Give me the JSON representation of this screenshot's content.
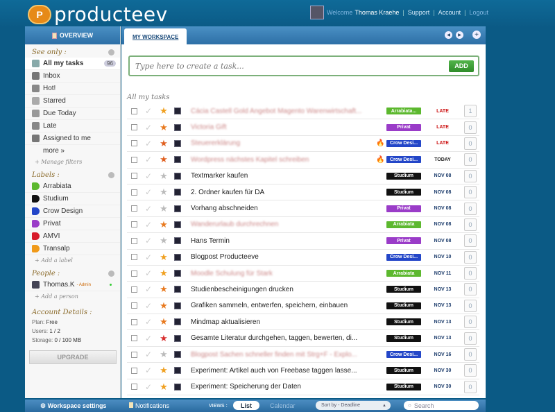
{
  "app": {
    "name": "producteev"
  },
  "user": {
    "welcome": "Welcome",
    "name": "Thomas Kraehe",
    "support": "Support",
    "account": "Account",
    "logout": "Logout"
  },
  "sidebar": {
    "tab": "OVERVIEW",
    "see_only_title": "See only :",
    "see_only": [
      {
        "label": "All my tasks",
        "count": "96",
        "icon": "list-icon",
        "color": "#8aa"
      },
      {
        "label": "Inbox",
        "icon": "inbox-icon",
        "color": "#777"
      },
      {
        "label": "Hot!",
        "icon": "fire-icon",
        "color": "#888"
      },
      {
        "label": "Starred",
        "icon": "star-icon",
        "color": "#aaa"
      },
      {
        "label": "Due Today",
        "icon": "calendar-icon",
        "color": "#999"
      },
      {
        "label": "Late",
        "icon": "warning-icon",
        "color": "#888"
      },
      {
        "label": "Assigned to me",
        "icon": "assign-icon",
        "color": "#777"
      }
    ],
    "more": "more »",
    "manage_filters": "Manage filters",
    "labels_title": "Labels :",
    "labels": [
      {
        "label": "Arrabiata",
        "color": "#5cb82e"
      },
      {
        "label": "Studium",
        "color": "#111111"
      },
      {
        "label": "Crow Design",
        "color": "#2346c8"
      },
      {
        "label": "Privat",
        "color": "#9a3cc8"
      },
      {
        "label": "AMVI",
        "color": "#d81b2b"
      },
      {
        "label": "Transalp",
        "color": "#f09a1a"
      }
    ],
    "add_label": "Add a label",
    "people_title": "People :",
    "person": {
      "name": "Thomas.K",
      "role": "- Admin"
    },
    "add_person": "Add a person",
    "account_title": "Account Details :",
    "plan_label": "Plan:",
    "plan": "Free",
    "users_label": "Users:",
    "users": "1 / 2",
    "storage_label": "Storage:",
    "storage": "0 / 100 MB",
    "upgrade": "UPGRADE"
  },
  "main": {
    "tab": "MY WORKSPACE",
    "task_placeholder": "Type here to create a task...",
    "add": "ADD",
    "list_title": "All my tasks"
  },
  "tasks": [
    {
      "title": "Cácia Castell Gold Angebot Magento Warenwirtschaft...",
      "blur": true,
      "label": "Arrabiata...",
      "label_color": "#5cb82e",
      "fire": false,
      "due": "LATE",
      "due_color": "#cc1111",
      "comments": "1",
      "star": "#f0a020"
    },
    {
      "title": "Victoria Gift",
      "blur": true,
      "label": "Privat",
      "label_color": "#9a3cc8",
      "fire": false,
      "due": "LATE",
      "due_color": "#cc1111",
      "comments": "0",
      "star": "#e87a20"
    },
    {
      "title": "Steuererklärung",
      "blur": true,
      "label": "Crow Desi...",
      "label_color": "#2346c8",
      "fire": true,
      "due": "LATE",
      "due_color": "#cc1111",
      "comments": "0",
      "star": "#e06020"
    },
    {
      "title": "Wordpress nächstes Kapitel schreiben",
      "blur": true,
      "label": "Crow Desi...",
      "label_color": "#2346c8",
      "fire": true,
      "due": "TODAY",
      "due_color": "#222222",
      "comments": "0",
      "star": "#e06020"
    },
    {
      "title": "Textmarker kaufen",
      "blur": false,
      "label": "Studium",
      "label_color": "#111111",
      "fire": false,
      "due": "NOV 08",
      "due_color": "#1a3a6a",
      "comments": "0",
      "star": "#bbbbbb"
    },
    {
      "title": "2. Ordner kaufen für DA",
      "blur": false,
      "label": "Studium",
      "label_color": "#111111",
      "fire": false,
      "due": "NOV 08",
      "due_color": "#1a3a6a",
      "comments": "0",
      "star": "#bbbbbb"
    },
    {
      "title": "Vorhang abschneiden",
      "blur": false,
      "label": "Privat",
      "label_color": "#9a3cc8",
      "fire": false,
      "due": "NOV 08",
      "due_color": "#1a3a6a",
      "comments": "0",
      "star": "#bbbbbb"
    },
    {
      "title": "Wanderurlaub durchrechnen",
      "blur": true,
      "label": "Arrabiata",
      "label_color": "#5cb82e",
      "fire": false,
      "due": "NOV 08",
      "due_color": "#1a3a6a",
      "comments": "0",
      "star": "#e87a20"
    },
    {
      "title": "Hans Termin",
      "blur": false,
      "label": "Privat",
      "label_color": "#9a3cc8",
      "fire": false,
      "due": "NOV 08",
      "due_color": "#1a3a6a",
      "comments": "0",
      "star": "#bbbbbb"
    },
    {
      "title": "Blogpost Producteeve",
      "blur": false,
      "label": "Crow Desi...",
      "label_color": "#2346c8",
      "fire": false,
      "due": "NOV 10",
      "due_color": "#1a3a6a",
      "comments": "0",
      "star": "#f0a020"
    },
    {
      "title": "Moodle Schulung für Stark",
      "blur": true,
      "label": "Arrabiata",
      "label_color": "#5cb82e",
      "fire": false,
      "due": "NOV 11",
      "due_color": "#1a3a6a",
      "comments": "0",
      "star": "#f0a020"
    },
    {
      "title": "Studienbescheinigungen drucken",
      "blur": false,
      "label": "Studium",
      "label_color": "#111111",
      "fire": false,
      "due": "NOV 13",
      "due_color": "#1a3a6a",
      "comments": "0",
      "star": "#e87a20"
    },
    {
      "title": "Grafiken sammeln, entwerfen, speichern, einbauen",
      "blur": false,
      "label": "Studium",
      "label_color": "#111111",
      "fire": false,
      "due": "NOV 13",
      "due_color": "#1a3a6a",
      "comments": "0",
      "star": "#e87a20"
    },
    {
      "title": "Mindmap aktualisieren",
      "blur": false,
      "label": "Studium",
      "label_color": "#111111",
      "fire": false,
      "due": "NOV 13",
      "due_color": "#1a3a6a",
      "comments": "0",
      "star": "#e87a20"
    },
    {
      "title": "Gesamte Literatur durchgehen, taggen, bewerten, di...",
      "blur": false,
      "label": "Studium",
      "label_color": "#111111",
      "fire": false,
      "due": "NOV 13",
      "due_color": "#1a3a6a",
      "comments": "0",
      "star": "#d83030"
    },
    {
      "title": "Blogpost Sachen schneller finden mit Strg+F - Explo...",
      "blur": true,
      "label": "Crow Desi...",
      "label_color": "#2346c8",
      "fire": false,
      "due": "NOV 16",
      "due_color": "#1a3a6a",
      "comments": "0",
      "star": "#bbbbbb"
    },
    {
      "title": "Experiment: Artikel auch von Freebase taggen lasse...",
      "blur": false,
      "label": "Studium",
      "label_color": "#111111",
      "fire": false,
      "due": "NOV 30",
      "due_color": "#1a3a6a",
      "comments": "0",
      "star": "#f0a020"
    },
    {
      "title": "Experiment: Speicherung der Daten",
      "blur": false,
      "label": "Studium",
      "label_color": "#111111",
      "fire": false,
      "due": "NOV 30",
      "due_color": "#1a3a6a",
      "comments": "0",
      "star": "#f0a020"
    }
  ],
  "footer": {
    "workspace_settings": "Workspace settings",
    "notifications": "Notifications",
    "views": "VIEWS :",
    "list": "List",
    "calendar": "Calendar",
    "sort": "Sort by - Deadline",
    "search": "Search"
  }
}
